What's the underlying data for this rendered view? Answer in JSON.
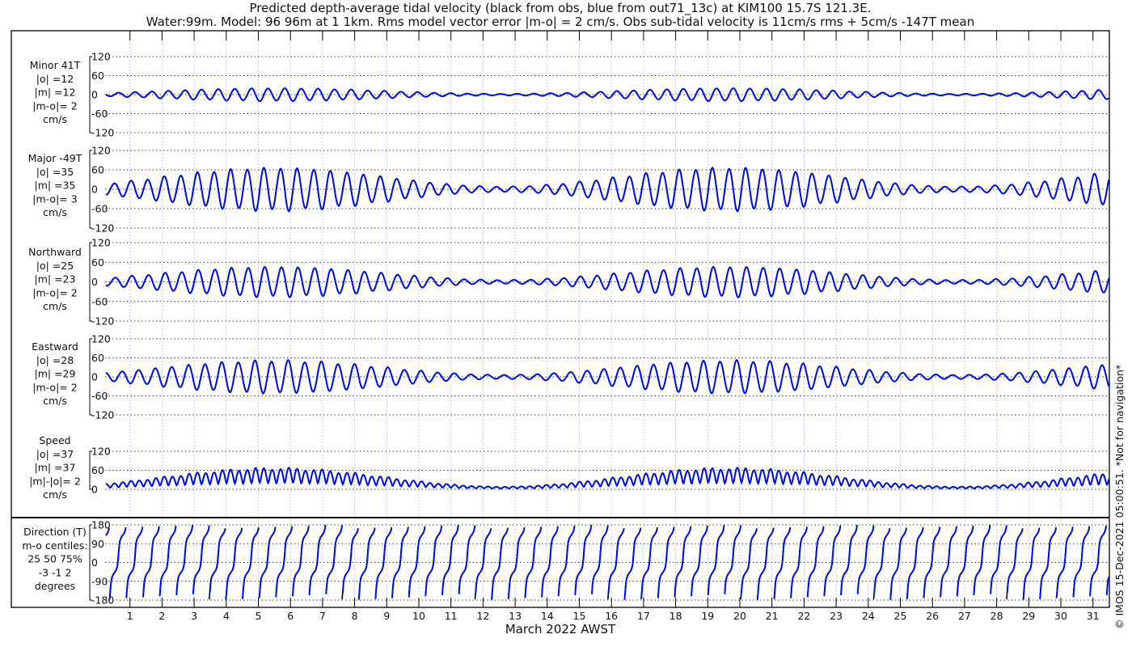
{
  "chart_data": {
    "type": "line",
    "title": "Predicted depth-average tidal velocity (black from obs, blue from out71_13c) at KIM100 15.7S 121.3E.",
    "subtitle": "Water:99m. Model: 96 96m at 1 1km. Rms model vector error |m-o| = 2 cm/s. Obs sub-tidal velocity is 11cm/s rms + 5cm/s -147T mean",
    "xlabel": "March 2022 AWST",
    "x_ticks": [
      "1",
      "2",
      "3",
      "4",
      "5",
      "6",
      "7",
      "8",
      "9",
      "10",
      "11",
      "12",
      "13",
      "14",
      "15",
      "16",
      "17",
      "18",
      "19",
      "20",
      "21",
      "22",
      "23",
      "24",
      "25",
      "26",
      "27",
      "28",
      "29",
      "30",
      "31"
    ],
    "xlim": [
      0,
      31.5
    ],
    "series_legend": [
      {
        "name": "obs",
        "color": "#000000"
      },
      {
        "name": "model out71_13c",
        "color": "#0000ee"
      }
    ],
    "tide": {
      "period_days": 0.5175,
      "spring_day": 5.5,
      "spring_neap_period_days": 14.2,
      "major_dir_T": -49,
      "minor_dir_T": 41,
      "major_peak_spring": 65,
      "major_peak_neap": 8,
      "minor_ratio": 0.34
    },
    "panels": [
      {
        "id": "minor",
        "label_lines": [
          "Minor 41T",
          "|o| =12",
          "|m| =12",
          "|m-o|= 2",
          "cm/s"
        ],
        "ylim": [
          -120,
          120
        ],
        "yticks": [
          "120",
          "60",
          "0",
          "-60",
          "-120"
        ],
        "ytick_values": [
          120,
          60,
          0,
          -60,
          -120
        ]
      },
      {
        "id": "major",
        "label_lines": [
          "Major -49T",
          "|o| =35",
          "|m| =35",
          "|m-o|= 3",
          "cm/s"
        ],
        "ylim": [
          -120,
          120
        ],
        "yticks": [
          "120",
          "60",
          "0",
          "-60",
          "-120"
        ],
        "ytick_values": [
          120,
          60,
          0,
          -60,
          -120
        ]
      },
      {
        "id": "north",
        "label_lines": [
          "Northward",
          "|o| =25",
          "|m| =23",
          "|m-o|= 2",
          "cm/s"
        ],
        "ylim": [
          -120,
          120
        ],
        "yticks": [
          "120",
          "60",
          "0",
          "-60",
          "-120"
        ],
        "ytick_values": [
          120,
          60,
          0,
          -60,
          -120
        ]
      },
      {
        "id": "east",
        "label_lines": [
          "Eastward",
          "|o| =28",
          "|m| =29",
          "|m-o|= 2",
          "cm/s"
        ],
        "ylim": [
          -120,
          120
        ],
        "yticks": [
          "120",
          "60",
          "0",
          "-60",
          "-120"
        ],
        "ytick_values": [
          120,
          60,
          0,
          -60,
          -120
        ]
      },
      {
        "id": "speed",
        "label_lines": [
          "Speed",
          "|o| =37",
          "|m| =37",
          "|m|-|o|= 2",
          "cm/s"
        ],
        "ylim": [
          0,
          120
        ],
        "yticks": [
          "120",
          "60",
          "0"
        ],
        "ytick_values": [
          120,
          60,
          0
        ]
      },
      {
        "id": "direction",
        "label_lines": [
          "Direction (T)",
          "m-o centiles:",
          "25  50  75%",
          "-3 -1  2",
          "degrees"
        ],
        "ylim": [
          -180,
          180
        ],
        "yticks": [
          "180",
          "90",
          "0",
          "-90",
          "-180"
        ],
        "ytick_values": [
          180,
          90,
          0,
          -90,
          -180
        ]
      }
    ],
    "grid": true
  },
  "footer": {
    "copyright": "© IMOS 15-Dec-2021 05:00:51. *Not for navigation*"
  }
}
